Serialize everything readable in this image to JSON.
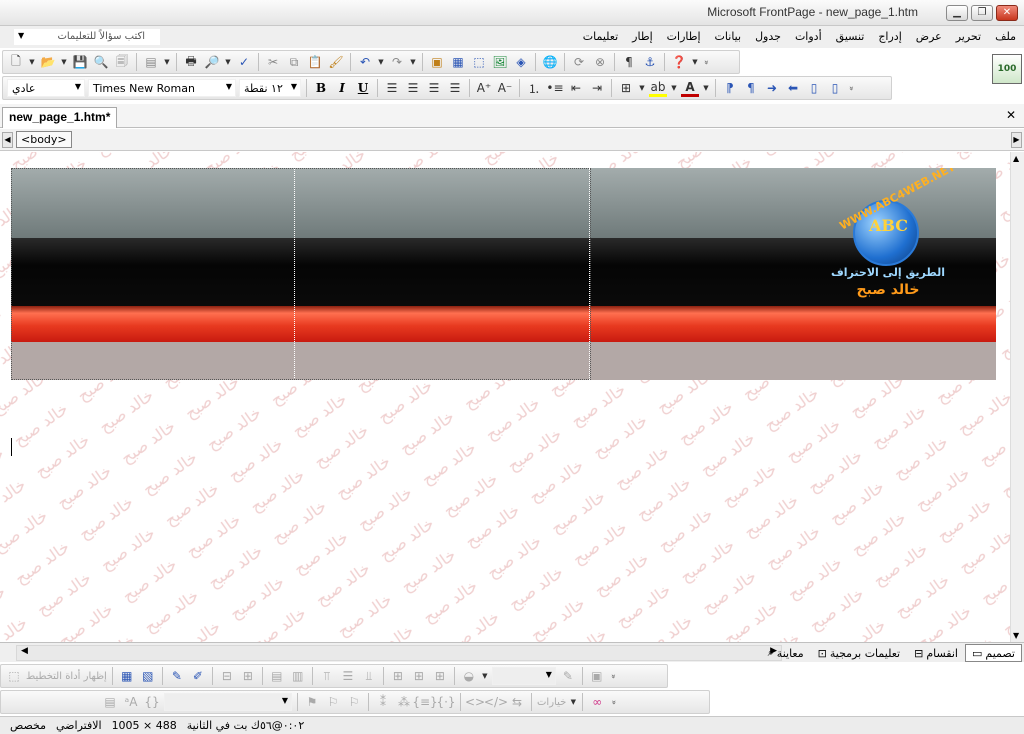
{
  "window": {
    "title": "Microsoft FrontPage - new_page_1.htm",
    "min_glyph": "▁",
    "restore_glyph": "❐",
    "close_glyph": "✕"
  },
  "menu": {
    "items": [
      "ملف",
      "تحرير",
      "عرض",
      "إدراج",
      "تنسيق",
      "أدوات",
      "جدول",
      "بيانات",
      "إطارات",
      "إطار",
      "تعليمات"
    ],
    "ask_placeholder": "اكتب سؤالاً للتعليمات"
  },
  "app_icon": {
    "text": "100"
  },
  "formatting": {
    "style_value": "عادي",
    "font_value": "Times New Roman",
    "size_value": "١٢ نقطة"
  },
  "document": {
    "tab_label": "new_page_1.htm*",
    "close_glyph": "✕",
    "quick_tag": "<body>"
  },
  "logo": {
    "ring_text": "WWW.ABC4WEB.NET",
    "letters": "ABC",
    "tagline": "الطريق إلى الاحتراف",
    "author": "خالد صبح"
  },
  "watermark_text": "خالد صبح",
  "view_tabs": [
    "تصميم",
    "انقسام",
    "تعليمات برمجية",
    "معاينة"
  ],
  "bottom_toolbar": {
    "show_layout_tool": "إظهار أداة التخطيط",
    "options_label": "خيارات"
  },
  "status": {
    "download_time": "٠:٠٢@٥٦ك بت في الثانية",
    "dimensions": "1005 × 488",
    "mode_default": "الافتراضي",
    "mode_custom": "مخصص"
  },
  "colors": {
    "highlight": "#ffff00",
    "font_color": "#c00000",
    "banner_red": "#e83a20"
  }
}
